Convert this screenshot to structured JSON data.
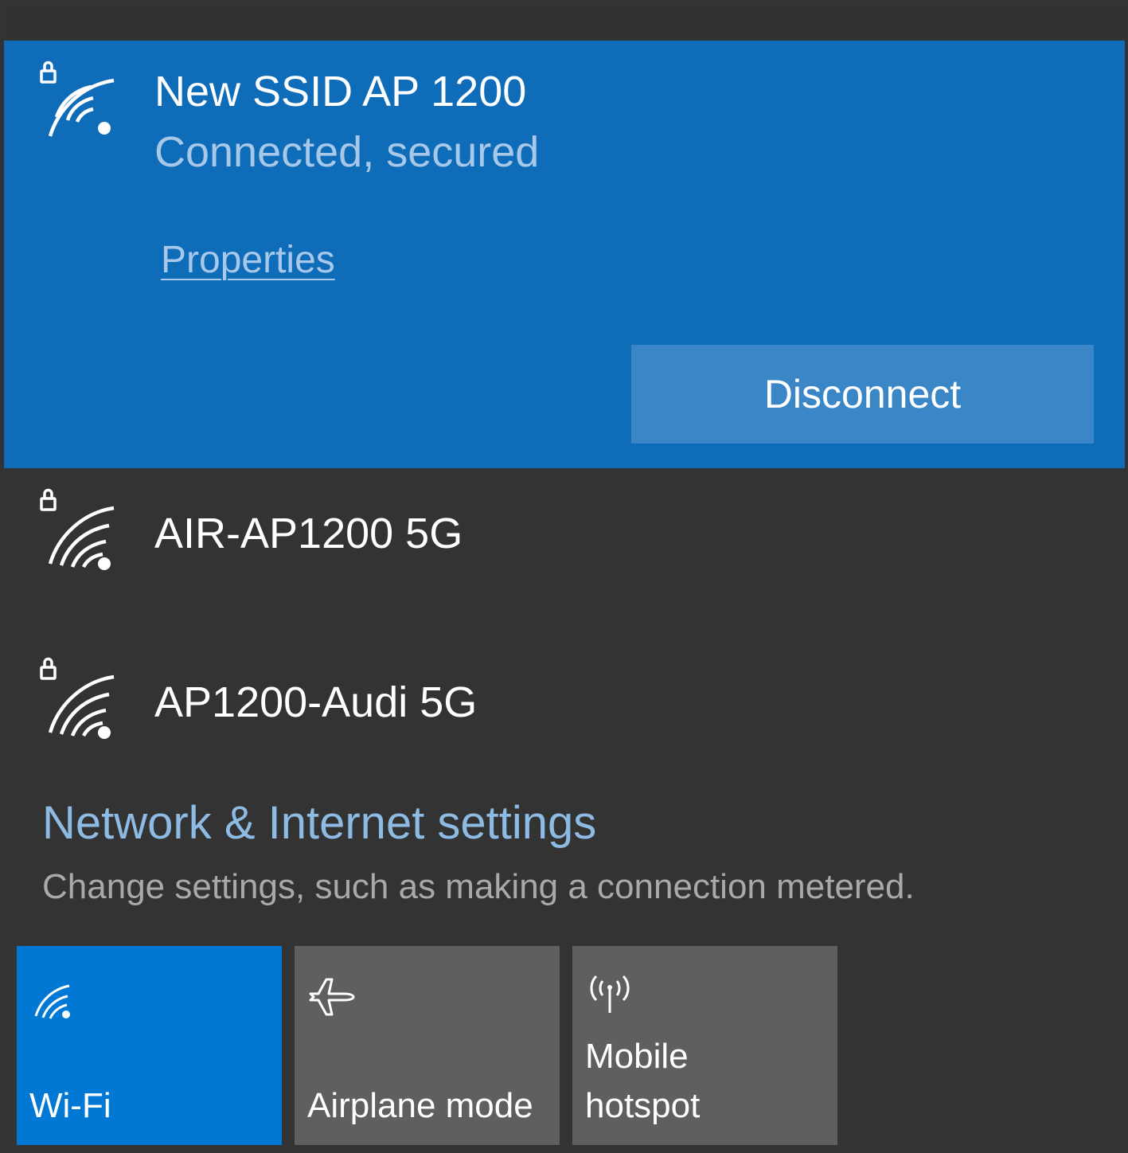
{
  "connected_network": {
    "name": "New SSID AP 1200",
    "status": "Connected, secured",
    "properties_label": "Properties",
    "disconnect_label": "Disconnect",
    "icon": "wifi-secured-icon"
  },
  "networks": [
    {
      "name": "AIR-AP1200 5G",
      "icon": "wifi-secured-icon"
    },
    {
      "name": "AP1200-Audi 5G",
      "icon": "wifi-secured-icon"
    }
  ],
  "settings": {
    "title": "Network & Internet settings",
    "description": "Change settings, such as making a connection metered."
  },
  "quick_actions": [
    {
      "label": "Wi-Fi",
      "icon": "wifi-icon",
      "active": true
    },
    {
      "label": "Airplane mode",
      "icon": "airplane-icon",
      "active": false
    },
    {
      "label_line1": "Mobile",
      "label_line2": "hotspot",
      "icon": "mobile-hotspot-icon",
      "active": false
    }
  ],
  "colors": {
    "connected_bg": "#0e6cb8",
    "panel_bg": "#333333",
    "accent": "#0078d4",
    "tile_bg": "#5f5f5f",
    "link": "#8dbbe4"
  }
}
